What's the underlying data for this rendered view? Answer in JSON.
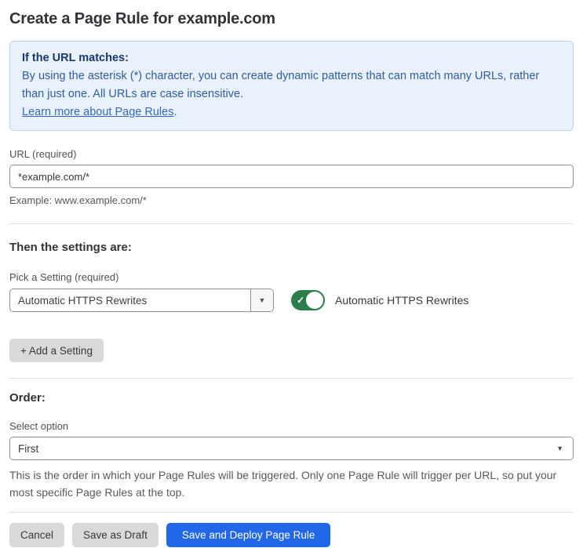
{
  "page": {
    "title": "Create a Page Rule for example.com"
  },
  "info_box": {
    "heading": "If the URL matches:",
    "body": "By using the asterisk (*) character, you can create dynamic patterns that can match many URLs, rather than just one. All URLs are case insensitive.",
    "link_label": "Learn more about Page Rules",
    "link_suffix": "."
  },
  "url_field": {
    "label": "URL (required)",
    "value": "*example.com/*",
    "helper": "Example: www.example.com/*"
  },
  "settings_section": {
    "heading": "Then the settings are:",
    "picker_label": "Pick a Setting (required)",
    "picker_value": "Automatic HTTPS Rewrites",
    "toggle_state": "on",
    "toggle_label": "Automatic HTTPS Rewrites",
    "add_button_label": "+ Add a Setting"
  },
  "order_section": {
    "heading": "Order:",
    "select_label": "Select option",
    "select_value": "First",
    "helper": "This is the order in which your Page Rules will be triggered. Only one Page Rule will trigger per URL, so put your most specific Page Rules at the top."
  },
  "footer": {
    "cancel_label": "Cancel",
    "save_draft_label": "Save as Draft",
    "save_deploy_label": "Save and Deploy Page Rule"
  },
  "colors": {
    "accent_blue": "#2167e8",
    "toggle_green": "#2d7d4c",
    "info_background": "#e9f2fc",
    "info_border": "#b9d5f1",
    "info_heading_text": "#17376e",
    "info_body_text": "#2d5da2",
    "link_text": "#3168c4",
    "button_gray": "#d9d9d9"
  },
  "icons": {
    "dropdown_arrow": "▼",
    "toggle_check": "✓"
  }
}
